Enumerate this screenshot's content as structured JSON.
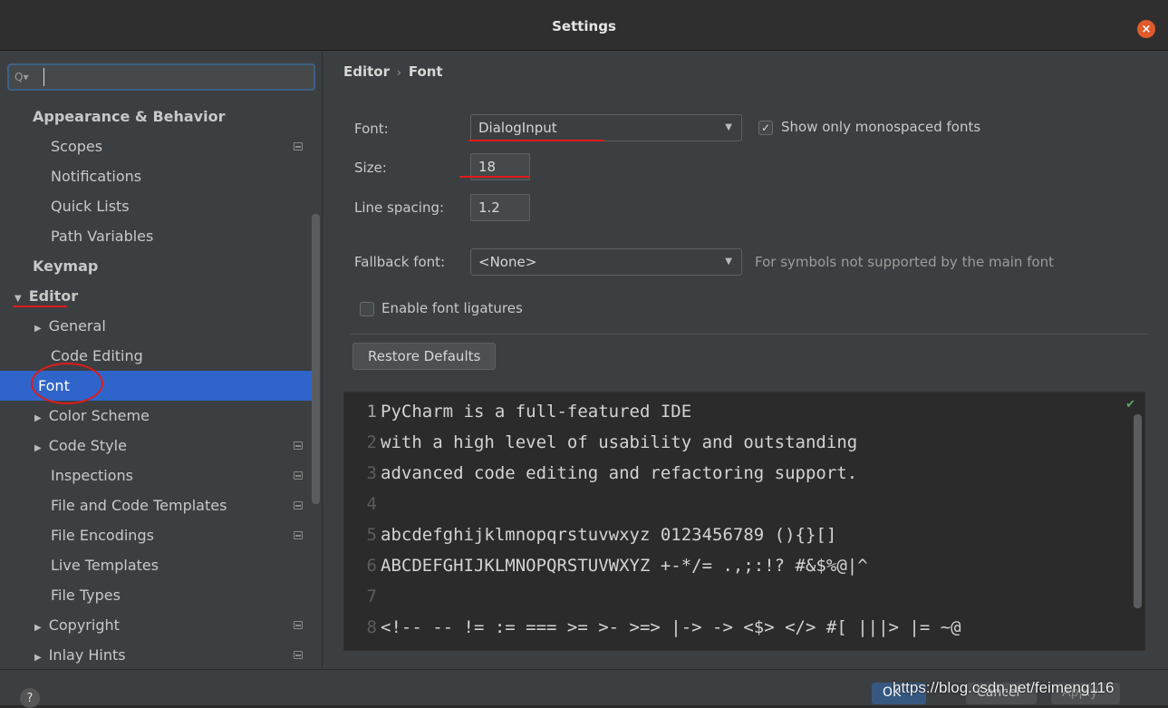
{
  "window": {
    "title": "Settings"
  },
  "sidebar": {
    "search": {
      "value": "",
      "placeholder": ""
    },
    "items": [
      {
        "label": "Appearance & Behavior",
        "level": 0,
        "bold": true
      },
      {
        "label": "Scopes",
        "level": 1,
        "project_icon": true
      },
      {
        "label": "Notifications",
        "level": 1
      },
      {
        "label": "Quick Lists",
        "level": 1
      },
      {
        "label": "Path Variables",
        "level": 1
      },
      {
        "label": "Keymap",
        "level": 0,
        "bold": true
      },
      {
        "label": "Editor",
        "level": 0,
        "bold": true,
        "expanded": true
      },
      {
        "label": "General",
        "level": 1,
        "collapsed": true
      },
      {
        "label": "Code Editing",
        "level": 1
      },
      {
        "label": "Font",
        "level": 1,
        "selected": true
      },
      {
        "label": "Color Scheme",
        "level": 1,
        "collapsed": true
      },
      {
        "label": "Code Style",
        "level": 1,
        "collapsed": true,
        "project_icon": true
      },
      {
        "label": "Inspections",
        "level": 1,
        "project_icon": true
      },
      {
        "label": "File and Code Templates",
        "level": 1,
        "project_icon": true
      },
      {
        "label": "File Encodings",
        "level": 1,
        "project_icon": true
      },
      {
        "label": "Live Templates",
        "level": 1
      },
      {
        "label": "File Types",
        "level": 1
      },
      {
        "label": "Copyright",
        "level": 1,
        "collapsed": true,
        "project_icon": true
      },
      {
        "label": "Inlay Hints",
        "level": 1,
        "collapsed": true,
        "project_icon": true
      }
    ]
  },
  "breadcrumb": {
    "parent": "Editor",
    "separator": "›",
    "current": "Font"
  },
  "font_settings": {
    "font_label": "Font:",
    "font_value": "DialogInput",
    "show_mono_label": "Show only monospaced fonts",
    "show_mono_checked": true,
    "size_label": "Size:",
    "size_value": "18",
    "line_spacing_label": "Line spacing:",
    "line_spacing_value": "1.2",
    "fallback_label": "Fallback font:",
    "fallback_value": "<None>",
    "fallback_hint": "For symbols not supported by the main font",
    "ligatures_label": "Enable font ligatures",
    "ligatures_checked": false,
    "restore_label": "Restore Defaults"
  },
  "preview": {
    "lines": [
      {
        "num": "1",
        "text": "PyCharm is a full-featured IDE"
      },
      {
        "num": "2",
        "text": "with a high level of usability and outstanding"
      },
      {
        "num": "3",
        "text": "advanced code editing and refactoring support."
      },
      {
        "num": "4",
        "text": ""
      },
      {
        "num": "5",
        "text": "abcdefghijklmnopqrstuvwxyz 0123456789 (){}[]"
      },
      {
        "num": "6",
        "text": "ABCDEFGHIJKLMNOPQRSTUVWXYZ +-*/= .,;:!? #&$%@|^"
      },
      {
        "num": "7",
        "text": ""
      },
      {
        "num": "8",
        "text": "<!-- -- != := === >= >- >=> |-> -> <$> </> #[ |||> |= ~@"
      }
    ]
  },
  "footer": {
    "help": "?",
    "ok": "OK",
    "cancel": "Cancel",
    "apply": "Apply",
    "watermark": "https://blog.csdn.net/feimeng116"
  },
  "colors": {
    "selection": "#2f65ca",
    "annotation_red": "#e01b1b",
    "close_button": "#e05a2b"
  }
}
